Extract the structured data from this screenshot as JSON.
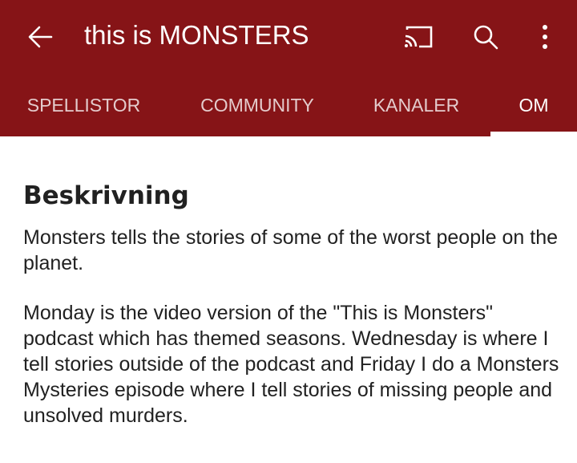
{
  "app": {
    "title": "this is MONSTERS",
    "background_color": "#861417",
    "icons": [
      "back-arrow-icon",
      "cast-icon",
      "search-icon",
      "more-vert-icon"
    ]
  },
  "tabs": [
    {
      "label": "SPELLISTOR",
      "active": false
    },
    {
      "label": "COMMUNITY",
      "active": false
    },
    {
      "label": "KANALER",
      "active": false
    },
    {
      "label": "OM",
      "active": true
    }
  ],
  "about": {
    "heading": "Beskrivning",
    "paragraphs": [
      "Monsters tells the stories of some of the worst people on the planet.",
      "Monday is the video version of the \"This is Monsters\" podcast which has themed seasons. Wednesday is where I tell stories outside of the podcast and Friday I do a Monsters Mysteries episode where I tell stories of missing people and unsolved murders."
    ]
  }
}
